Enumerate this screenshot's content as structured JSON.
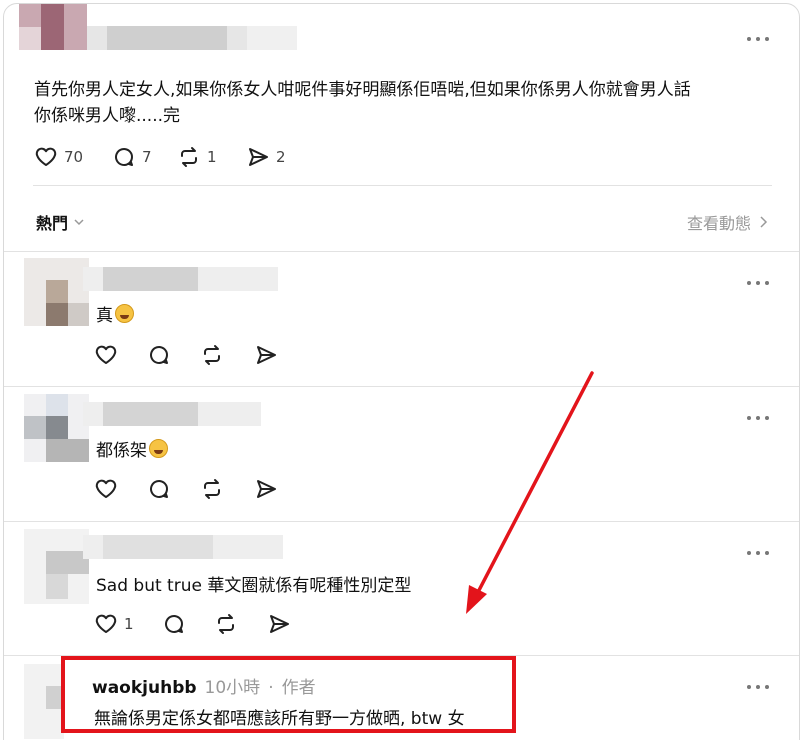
{
  "post": {
    "text_line1": "首先你男人定女人,如果你係女人咁呢件事好明顯係佢唔啱,但如果你係男人你就會男人話",
    "text_line2": "你係咪男人嚟.....完",
    "likes": "70",
    "comments": "7",
    "reposts": "1",
    "shares": "2"
  },
  "sort": {
    "label": "熱門",
    "view_activity": "查看動態"
  },
  "replies": [
    {
      "text": "真",
      "emoji": "squinting-face-emoji",
      "likes": ""
    },
    {
      "text": "都係架",
      "emoji": "face-with-hand-emoji",
      "likes": ""
    },
    {
      "text": "Sad but true 華文圈就係有呢種性別定型",
      "likes": "1"
    },
    {
      "username": "waokjuhbb",
      "time": "10小時",
      "separator": "·",
      "author_tag": "作者",
      "text": "無論係男定係女都唔應該所有野一方做晒, btw 女"
    }
  ],
  "colors": {
    "highlight": "#e3141b",
    "muted": "#999999"
  }
}
